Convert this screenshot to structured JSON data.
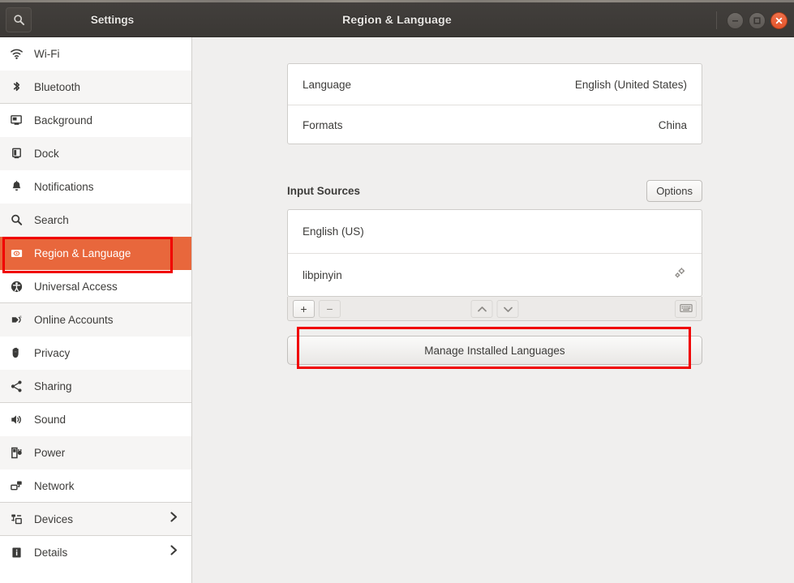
{
  "window": {
    "title": "Region & Language",
    "search_icon": "search-icon",
    "controls": {
      "minimize": "minimize-icon",
      "maximize": "maximize-icon",
      "close": "close-icon"
    }
  },
  "sidebar": {
    "header_label": "Settings",
    "items": [
      {
        "label": "Wi-Fi",
        "icon": "wifi-icon",
        "chevron": "",
        "selected": false
      },
      {
        "label": "Bluetooth",
        "icon": "bluetooth-icon",
        "chevron": "",
        "selected": false
      },
      {
        "label": "Background",
        "icon": "background-icon",
        "chevron": "",
        "selected": false
      },
      {
        "label": "Dock",
        "icon": "dock-icon",
        "chevron": "",
        "selected": false
      },
      {
        "label": "Notifications",
        "icon": "bell-icon",
        "chevron": "",
        "selected": false
      },
      {
        "label": "Search",
        "icon": "search-icon",
        "chevron": "",
        "selected": false
      },
      {
        "label": "Region & Language",
        "icon": "region-language-icon",
        "chevron": "",
        "selected": true
      },
      {
        "label": "Universal Access",
        "icon": "accessibility-icon",
        "chevron": "",
        "selected": false
      },
      {
        "label": "Online Accounts",
        "icon": "online-accounts-icon",
        "chevron": "",
        "selected": false
      },
      {
        "label": "Privacy",
        "icon": "hand-icon",
        "chevron": "",
        "selected": false
      },
      {
        "label": "Sharing",
        "icon": "share-icon",
        "chevron": "",
        "selected": false
      },
      {
        "label": "Sound",
        "icon": "speaker-icon",
        "chevron": "",
        "selected": false
      },
      {
        "label": "Power",
        "icon": "power-plug-icon",
        "chevron": "",
        "selected": false
      },
      {
        "label": "Network",
        "icon": "network-icon",
        "chevron": "",
        "selected": false
      },
      {
        "label": "Devices",
        "icon": "devices-icon",
        "chevron": "›",
        "selected": false
      },
      {
        "label": "Details",
        "icon": "info-icon",
        "chevron": "›",
        "selected": false
      }
    ]
  },
  "main": {
    "language_rows": [
      {
        "label": "Language",
        "value": "English (United States)"
      },
      {
        "label": "Formats",
        "value": "China"
      }
    ],
    "input_sources": {
      "title": "Input Sources",
      "options_label": "Options",
      "sources": [
        {
          "label": "English (US)",
          "has_settings": false
        },
        {
          "label": "libpinyin",
          "has_settings": true
        }
      ],
      "toolbar": {
        "add": "+",
        "remove": "−",
        "move_up": "⌃",
        "move_down": "⌄",
        "keyboard": "keyboard-icon"
      }
    },
    "manage_button_label": "Manage Installed Languages"
  },
  "colors": {
    "accent_orange": "#e8673c",
    "annotation_red": "#f00000",
    "titlebar": "#3f3c39",
    "content_bg": "#f0efee",
    "close_button": "#e4552b"
  }
}
